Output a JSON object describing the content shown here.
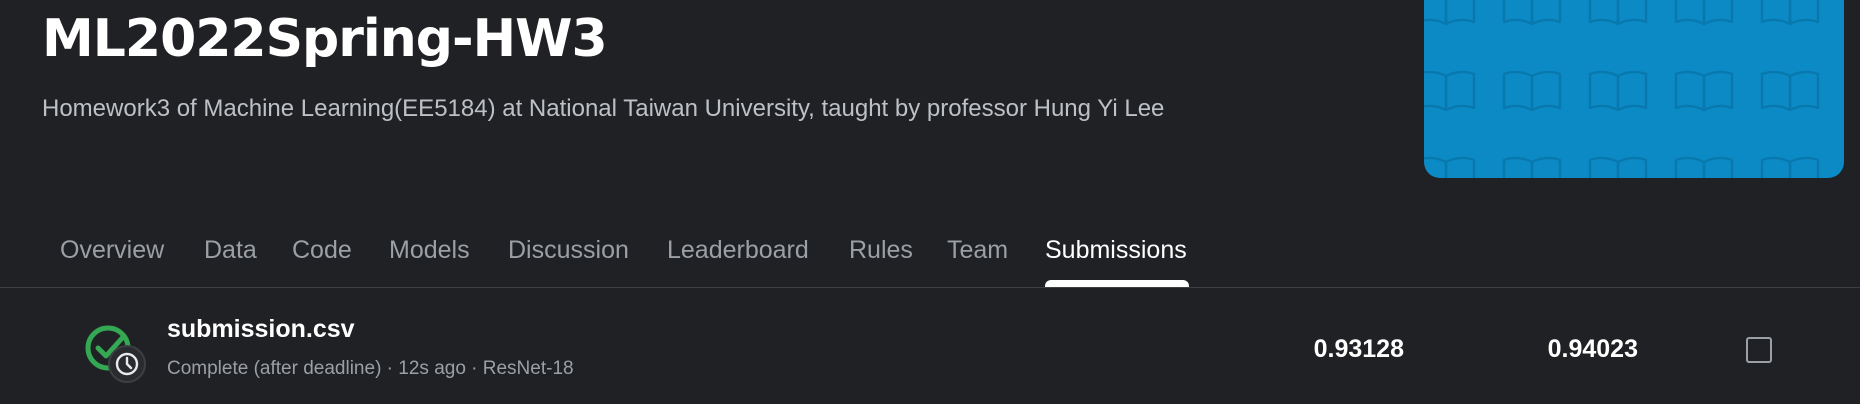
{
  "competition": {
    "title": "ML2022Spring-HW3",
    "subtitle": "Homework3 of Machine Learning(EE5184) at National Taiwan University, taught by professor Hung Yi Lee",
    "banner_color": "#0b8ac6"
  },
  "tabs": [
    {
      "label": "Overview"
    },
    {
      "label": "Data"
    },
    {
      "label": "Code"
    },
    {
      "label": "Models"
    },
    {
      "label": "Discussion"
    },
    {
      "label": "Leaderboard"
    },
    {
      "label": "Rules"
    },
    {
      "label": "Team"
    },
    {
      "label": "Submissions",
      "active": true
    }
  ],
  "submission": {
    "file_name": "submission.csv",
    "status_icon": "check-clock-icon",
    "meta": "Complete (after deadline) · 12s ago · ResNet-18",
    "private_score": "0.93128",
    "public_score": "0.94023",
    "selected": false
  },
  "colors": {
    "background": "#202124",
    "success": "#34a853",
    "active_tab": "#ffffff"
  }
}
